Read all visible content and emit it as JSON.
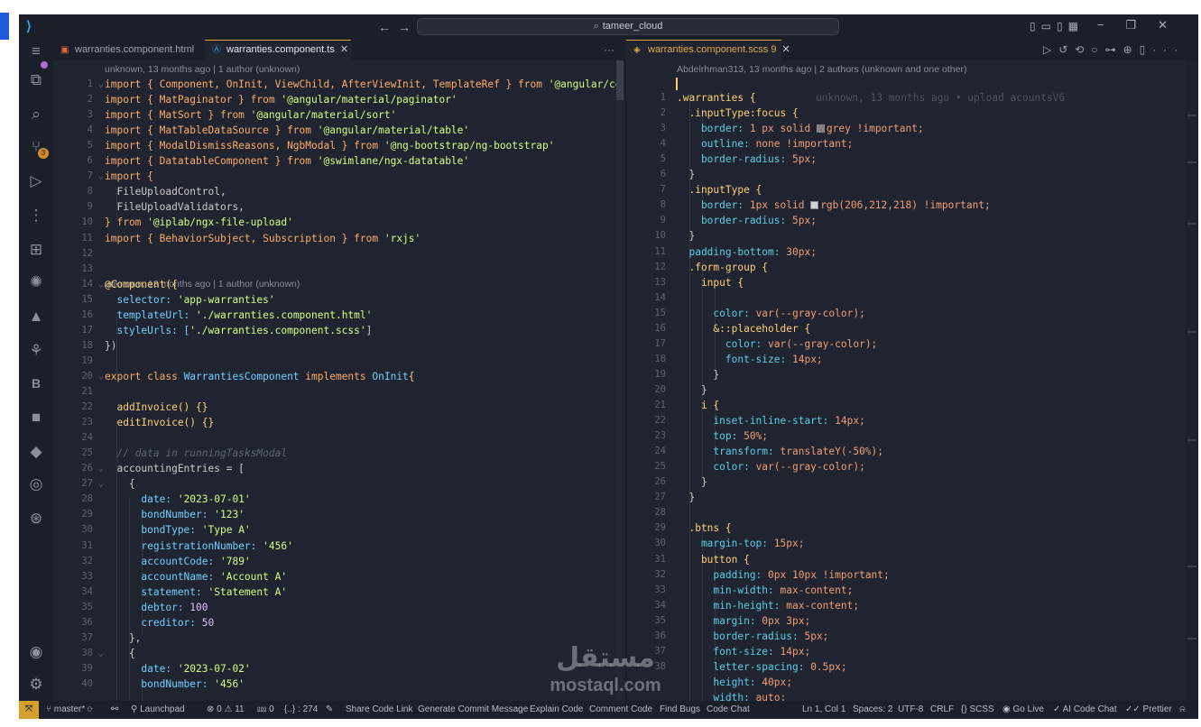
{
  "titlebar": {
    "search_text": "tameer_cloud",
    "win_minimize": "−",
    "win_restore": "❐",
    "win_close": "✕"
  },
  "tabs": {
    "left": [
      {
        "label": "warranties.component.html",
        "active": false
      },
      {
        "label": "warranties.component.ts",
        "active": true
      }
    ],
    "right": [
      {
        "label": "warranties.component.scss",
        "badge": "9",
        "active": true
      }
    ],
    "more": "···"
  },
  "activity": {
    "source_control_badge": "3"
  },
  "left_editor": {
    "blame_top": "unknown, 13 months ago | 1 author (unknown)",
    "blame_mid": "unknown, 13 months ago | 1 author (unknown)",
    "lines": [
      "1",
      "2",
      "3",
      "4",
      "5",
      "6",
      "7",
      "8",
      "9",
      "10",
      "11",
      "12",
      "13",
      "14",
      "15",
      "16",
      "17",
      "18",
      "19",
      "20",
      "21",
      "22",
      "23",
      "24",
      "25",
      "26",
      "27",
      "28",
      "29",
      "30",
      "31",
      "32",
      "33",
      "34",
      "35",
      "36",
      "37",
      "38",
      "39",
      "40"
    ],
    "code": {
      "l1a": "import { Component, OnInit, ViewChild, AfterViewInit, TemplateRef } from ",
      "l1b": "'@angular/co",
      "l2a": "import { MatPaginator } from ",
      "l2b": "'@angular/material/paginator'",
      "l3a": "import { MatSort } from ",
      "l3b": "'@angular/material/sort'",
      "l4a": "import { MatTableDataSource } from ",
      "l4b": "'@angular/material/table'",
      "l5a": "import { ModalDismissReasons, NgbModal } from ",
      "l5b": "'@ng-bootstrap/ng-bootstrap'",
      "l6a": "import { DatatableComponent } from ",
      "l6b": "'@swimlane/ngx-datatable'",
      "l7": "import {",
      "l8": "  FileUploadControl,",
      "l9": "  FileUploadValidators,",
      "l10a": "} from ",
      "l10b": "'@iplab/ngx-file-upload'",
      "l11a": "import { BehaviorSubject, Subscription } from ",
      "l11b": "'rxjs'",
      "l14": "@Component({",
      "l15a": "  selector: ",
      "l15b": "'app-warranties'",
      "l16a": "  templateUrl: ",
      "l16b": "'./warranties.component.html'",
      "l17a": "  styleUrls: [",
      "l17b": "'./warranties.component.scss'",
      "l17c": "]",
      "l18": "})",
      "l20a": "export class ",
      "l20b": "WarrantiesComponent",
      "l20c": " implements ",
      "l20d": "OnInit",
      "l20e": "{",
      "l22": "  addInvoice() {}",
      "l23": "  editInvoice() {}",
      "l25": "  // data in runningTasksModal",
      "l26": "  accountingEntries = [",
      "l27": "    {",
      "l28a": "      date: ",
      "l28b": "'2023-07-01'",
      "l29a": "      bondNumber: ",
      "l29b": "'123'",
      "l30a": "      bondType: ",
      "l30b": "'Type A'",
      "l31a": "      registrationNumber: ",
      "l31b": "'456'",
      "l32a": "      accountCode: ",
      "l32b": "'789'",
      "l33a": "      accountName: ",
      "l33b": "'Account A'",
      "l34a": "      statement: ",
      "l34b": "'Statement A'",
      "l35a": "      debtor: ",
      "l35b": "100",
      "l36a": "      creditor: ",
      "l36b": "50",
      "l37": "    },",
      "l38": "    {",
      "l39a": "      date: ",
      "l39b": "'2023-07-02'",
      "l40a": "      bondNumber: ",
      "l40b": "'456'"
    }
  },
  "right_editor": {
    "blame_top": "Abdelrhman313, 13 months ago | 2 authors (unknown and one other)",
    "inline_blame": "unknown, 13 months ago • upload acountsV6",
    "lines": [
      "1",
      "2",
      "3",
      "4",
      "5",
      "6",
      "7",
      "8",
      "9",
      "10",
      "11",
      "12",
      "13",
      "14",
      "15",
      "16",
      "17",
      "18",
      "19",
      "20",
      "21",
      "22",
      "23",
      "24",
      "25",
      "26",
      "27",
      "28",
      "29",
      "30",
      "31",
      "32",
      "33",
      "34",
      "35",
      "36",
      "37",
      "38"
    ],
    "code": {
      "r1": ".warranties {",
      "r2": "  .inputType:focus {",
      "r3a": "    border: ",
      "r3b": "1 px solid ",
      "r3c": "grey",
      "r3d": " !important;",
      "r4a": "    outline: ",
      "r4b": "none !important;",
      "r5a": "    border-radius: ",
      "r5b": "5px;",
      "r6": "  }",
      "r7": "  .inputType {",
      "r8a": "    border: ",
      "r8b": "1px solid ",
      "r8c": "rgb(206,212,218)",
      "r8d": " !important;",
      "r9a": "    border-radius: ",
      "r9b": "5px;",
      "r10": "  }",
      "r11a": "  padding-bottom: ",
      "r11b": "30px;",
      "r12": "  .form-group {",
      "r13": "    input {",
      "r15a": "      color: ",
      "r15b": "var(--gray-color);",
      "r16": "      &::placeholder {",
      "r17a": "        color: ",
      "r17b": "var(--gray-color);",
      "r18a": "        font-size: ",
      "r18b": "14px;",
      "r19": "      }",
      "r20": "    }",
      "r21": "    i {",
      "r22a": "      inset-inline-start: ",
      "r22b": "14px;",
      "r23a": "      top: ",
      "r23b": "50%;",
      "r24a": "      transform: ",
      "r24b": "translateY(-50%);",
      "r25a": "      color: ",
      "r25b": "var(--gray-color);",
      "r26": "    }",
      "r27": "  }",
      "r29": "  .btns {",
      "r30a": "    margin-top: ",
      "r30b": "15px;",
      "r31": "    button {",
      "r32a": "      padding: ",
      "r32b": "0px 10px !important;",
      "r33a": "      min-width: ",
      "r33b": "max-content;",
      "r34a": "      min-height: ",
      "r34b": "max-content;",
      "r35a": "      margin: ",
      "r35b": "0px 3px;",
      "r36a": "      border-radius: ",
      "r36b": "5px;",
      "r37a": "      font-size: ",
      "r37b": "14px;",
      "r38a": "      letter-spacing: ",
      "r38b": "0.5px;",
      "r39a": "      height: ",
      "r39b": "40px;",
      "r40a": "      width: ",
      "r40b": "auto;"
    }
  },
  "statusbar": {
    "branch": "master*",
    "launchpad": "Launchpad",
    "problems": "⊗ 0 ⚠ 11",
    "ports": "⅏ 0",
    "brackets": "{..} : 274",
    "share": "Share Code Link",
    "commit": "Generate Commit Message",
    "explain": "Explain Code",
    "comment": "Comment Code",
    "bugs": "Find Bugs",
    "chat": "Code Chat",
    "position": "Ln 1, Col 1",
    "spaces": "Spaces: 2",
    "encoding": "UTF-8",
    "eol": "CRLF",
    "language": "SCSS",
    "golive": "Go Live",
    "ai": "AI Code Chat",
    "prettier": "Prettier"
  },
  "watermark": {
    "arabic": "مستقل",
    "latin": "mostaql.com"
  },
  "colors": {
    "accent": "#d6a12a",
    "background": "#1f2430",
    "chrome": "#1b1f29"
  }
}
